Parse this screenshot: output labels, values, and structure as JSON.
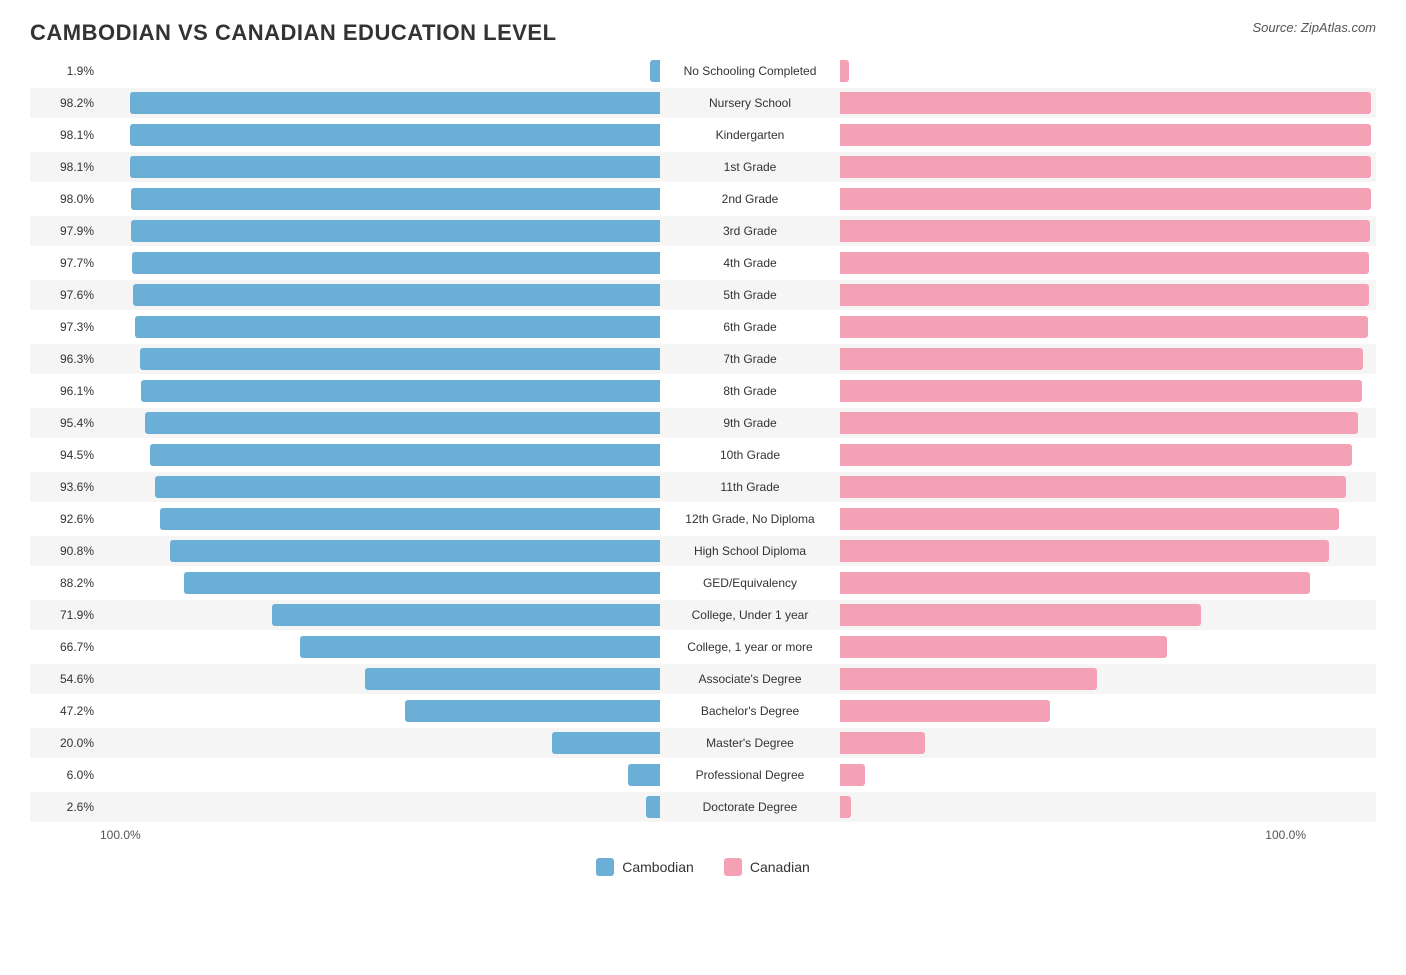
{
  "title": "CAMBODIAN VS CANADIAN EDUCATION LEVEL",
  "source": "Source: ZipAtlas.com",
  "colors": {
    "cambodian": "#6baed6",
    "canadian": "#f4a0b5"
  },
  "legend": {
    "cambodian_label": "Cambodian",
    "canadian_label": "Canadian"
  },
  "bottom_left": "100.0%",
  "bottom_right": "100.0%",
  "rows": [
    {
      "label": "No Schooling Completed",
      "left_pct": 1.9,
      "right_pct": 1.7,
      "left_val": "1.9%",
      "right_val": "1.7%",
      "striped": false
    },
    {
      "label": "Nursery School",
      "left_pct": 98.2,
      "right_pct": 98.4,
      "left_val": "98.2%",
      "right_val": "98.4%",
      "striped": true
    },
    {
      "label": "Kindergarten",
      "left_pct": 98.1,
      "right_pct": 98.4,
      "left_val": "98.1%",
      "right_val": "98.4%",
      "striped": false
    },
    {
      "label": "1st Grade",
      "left_pct": 98.1,
      "right_pct": 98.3,
      "left_val": "98.1%",
      "right_val": "98.3%",
      "striped": true
    },
    {
      "label": "2nd Grade",
      "left_pct": 98.0,
      "right_pct": 98.3,
      "left_val": "98.0%",
      "right_val": "98.3%",
      "striped": false
    },
    {
      "label": "3rd Grade",
      "left_pct": 97.9,
      "right_pct": 98.2,
      "left_val": "97.9%",
      "right_val": "98.2%",
      "striped": true
    },
    {
      "label": "4th Grade",
      "left_pct": 97.7,
      "right_pct": 98.0,
      "left_val": "97.7%",
      "right_val": "98.0%",
      "striped": false
    },
    {
      "label": "5th Grade",
      "left_pct": 97.6,
      "right_pct": 97.9,
      "left_val": "97.6%",
      "right_val": "97.9%",
      "striped": true
    },
    {
      "label": "6th Grade",
      "left_pct": 97.3,
      "right_pct": 97.7,
      "left_val": "97.3%",
      "right_val": "97.7%",
      "striped": false
    },
    {
      "label": "7th Grade",
      "left_pct": 96.3,
      "right_pct": 96.9,
      "left_val": "96.3%",
      "right_val": "96.9%",
      "striped": true
    },
    {
      "label": "8th Grade",
      "left_pct": 96.1,
      "right_pct": 96.6,
      "left_val": "96.1%",
      "right_val": "96.6%",
      "striped": false
    },
    {
      "label": "9th Grade",
      "left_pct": 95.4,
      "right_pct": 95.9,
      "left_val": "95.4%",
      "right_val": "95.9%",
      "striped": true
    },
    {
      "label": "10th Grade",
      "left_pct": 94.5,
      "right_pct": 94.9,
      "left_val": "94.5%",
      "right_val": "94.9%",
      "striped": false
    },
    {
      "label": "11th Grade",
      "left_pct": 93.6,
      "right_pct": 93.7,
      "left_val": "93.6%",
      "right_val": "93.7%",
      "striped": true
    },
    {
      "label": "12th Grade, No Diploma",
      "left_pct": 92.6,
      "right_pct": 92.4,
      "left_val": "92.6%",
      "right_val": "92.4%",
      "striped": false
    },
    {
      "label": "High School Diploma",
      "left_pct": 90.8,
      "right_pct": 90.6,
      "left_val": "90.8%",
      "right_val": "90.6%",
      "striped": true
    },
    {
      "label": "GED/Equivalency",
      "left_pct": 88.2,
      "right_pct": 87.1,
      "left_val": "88.2%",
      "right_val": "87.1%",
      "striped": false
    },
    {
      "label": "College, Under 1 year",
      "left_pct": 71.9,
      "right_pct": 66.8,
      "left_val": "71.9%",
      "right_val": "66.8%",
      "striped": true
    },
    {
      "label": "College, 1 year or more",
      "left_pct": 66.7,
      "right_pct": 60.6,
      "left_val": "66.7%",
      "right_val": "60.6%",
      "striped": false
    },
    {
      "label": "Associate's Degree",
      "left_pct": 54.6,
      "right_pct": 47.5,
      "left_val": "54.6%",
      "right_val": "47.5%",
      "striped": true
    },
    {
      "label": "Bachelor's Degree",
      "left_pct": 47.2,
      "right_pct": 38.8,
      "left_val": "47.2%",
      "right_val": "38.8%",
      "striped": false
    },
    {
      "label": "Master's Degree",
      "left_pct": 20.0,
      "right_pct": 15.7,
      "left_val": "20.0%",
      "right_val": "15.7%",
      "striped": true
    },
    {
      "label": "Professional Degree",
      "left_pct": 6.0,
      "right_pct": 4.7,
      "left_val": "6.0%",
      "right_val": "4.7%",
      "striped": false
    },
    {
      "label": "Doctorate Degree",
      "left_pct": 2.6,
      "right_pct": 2.0,
      "left_val": "2.6%",
      "right_val": "2.0%",
      "striped": true
    }
  ]
}
